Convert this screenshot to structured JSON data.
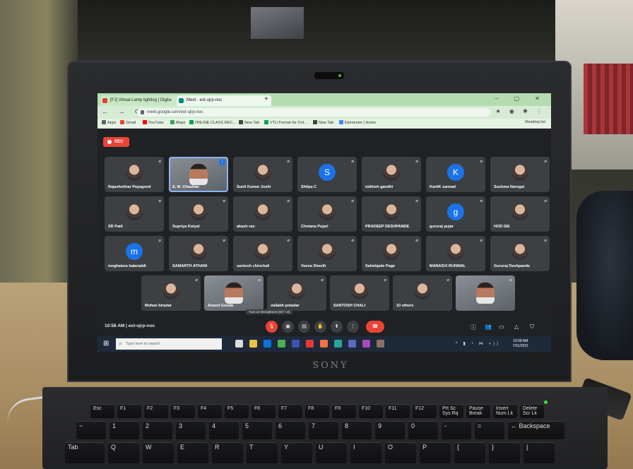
{
  "browser": {
    "tabs": [
      {
        "label": "[FJ] Virtual Lamp lighting | Digita"
      },
      {
        "label": "Meet - ext-ujrp-noc"
      }
    ],
    "url": "meet.google.com/ext-ujrp-noc",
    "bookmarks": [
      "Apps",
      "Gmail",
      "YouTube",
      "Maps",
      "ONLINE CLASS REC...",
      "New Tab",
      "VTU Format for Onl...",
      "New Tab",
      "Elementor | Home"
    ],
    "reading_list": "Reading list"
  },
  "meet": {
    "rec_label": "REC",
    "participants": [
      {
        "name": "Rajashekhar Payagond"
      },
      {
        "name": "S. M. Chauhan"
      },
      {
        "name": "Sunil Kumar Joshi"
      },
      {
        "name": "Shilpa C",
        "initial": "S",
        "color": "#1a73e8"
      },
      {
        "name": "nidhish gandhi"
      },
      {
        "name": "KartiK sarwad",
        "initial": "K",
        "color": "#1a73e8"
      },
      {
        "name": "Sushma Naregal"
      },
      {
        "name": "SR Patil"
      },
      {
        "name": "Supriya Kotyal"
      },
      {
        "name": "akash rao"
      },
      {
        "name": "Chetana Pujari"
      },
      {
        "name": "PRADEEP DESHPANDE"
      },
      {
        "name": "gururaj pujar",
        "initial": "g",
        "color": "#1a73e8"
      },
      {
        "name": "HOD ISE"
      },
      {
        "name": "meghatara balaraddi",
        "initial": "m",
        "color": "#1a73e8"
      },
      {
        "name": "SAMARTH ATHANI"
      },
      {
        "name": "santosh chinchali"
      },
      {
        "name": "Veena Sheelh"
      },
      {
        "name": "Sahebjade Page"
      },
      {
        "name": "MANASVI RUNWAL"
      },
      {
        "name": "Gururaj Deshpande"
      },
      {
        "name": "Mohan biradar"
      },
      {
        "name": "Anand Gouda"
      },
      {
        "name": "vallabh potadar"
      },
      {
        "name": "SANTOSH CHALI"
      },
      {
        "name": "10 others"
      },
      {
        "name": ""
      }
    ],
    "tooltip": "Turn on microphone (ctrl + d)",
    "time": "10:58 AM",
    "meeting_code": "ext-ujrp-noc"
  },
  "taskbar": {
    "search_placeholder": "Type here to search",
    "clock_time": "10:58 AM",
    "clock_date": "7/31/2021"
  },
  "device": {
    "brand": "SONY"
  },
  "keyboard": {
    "fn_row": [
      "Esc",
      "F1",
      "F2",
      "F3",
      "F4",
      "F5",
      "F6",
      "F7",
      "F8",
      "F9",
      "F10",
      "F11",
      "F12",
      "Prt Sc\nSys Rq",
      "Pause\nBreak",
      "Insert\nNum Lk",
      "Delete\nScr Lk"
    ],
    "num_row": [
      "~",
      "1",
      "2",
      "3",
      "4",
      "5",
      "6",
      "7",
      "8",
      "9",
      "0",
      "-",
      "=",
      "← Backspace"
    ],
    "q_row": [
      "Tab",
      "Q",
      "W",
      "E",
      "R",
      "T",
      "Y",
      "U",
      "I",
      "O",
      "P",
      "{",
      "}",
      "|"
    ]
  }
}
